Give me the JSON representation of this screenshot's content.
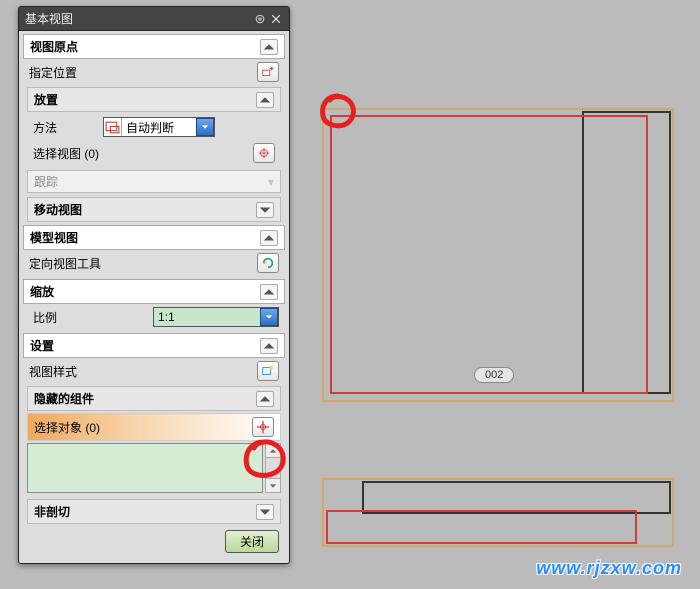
{
  "panel": {
    "title": "基本视图",
    "sections": {
      "view_origin": {
        "header": "视图原点"
      },
      "specify_pos": {
        "label": "指定位置"
      },
      "placement": {
        "header": "放置",
        "method_label": "方法",
        "method_value": "自动判断",
        "select_view_label": "选择视图 (0)",
        "track_label": "跟踪",
        "move_view_label": "移动视图"
      },
      "model_view": {
        "header": "模型视图",
        "orient_tool_label": "定向视图工具"
      },
      "scale": {
        "header": "缩放",
        "ratio_label": "比例",
        "ratio_value": "1:1"
      },
      "settings": {
        "header": "设置",
        "view_style_label": "视图样式",
        "hidden_comp_header": "隐藏的组件",
        "select_obj_label": "选择对象 (0)",
        "non_section_label": "非剖切"
      }
    },
    "close_button": "关闭"
  },
  "canvas": {
    "badge_label": "002"
  },
  "watermark": "www.rjzxw.com"
}
